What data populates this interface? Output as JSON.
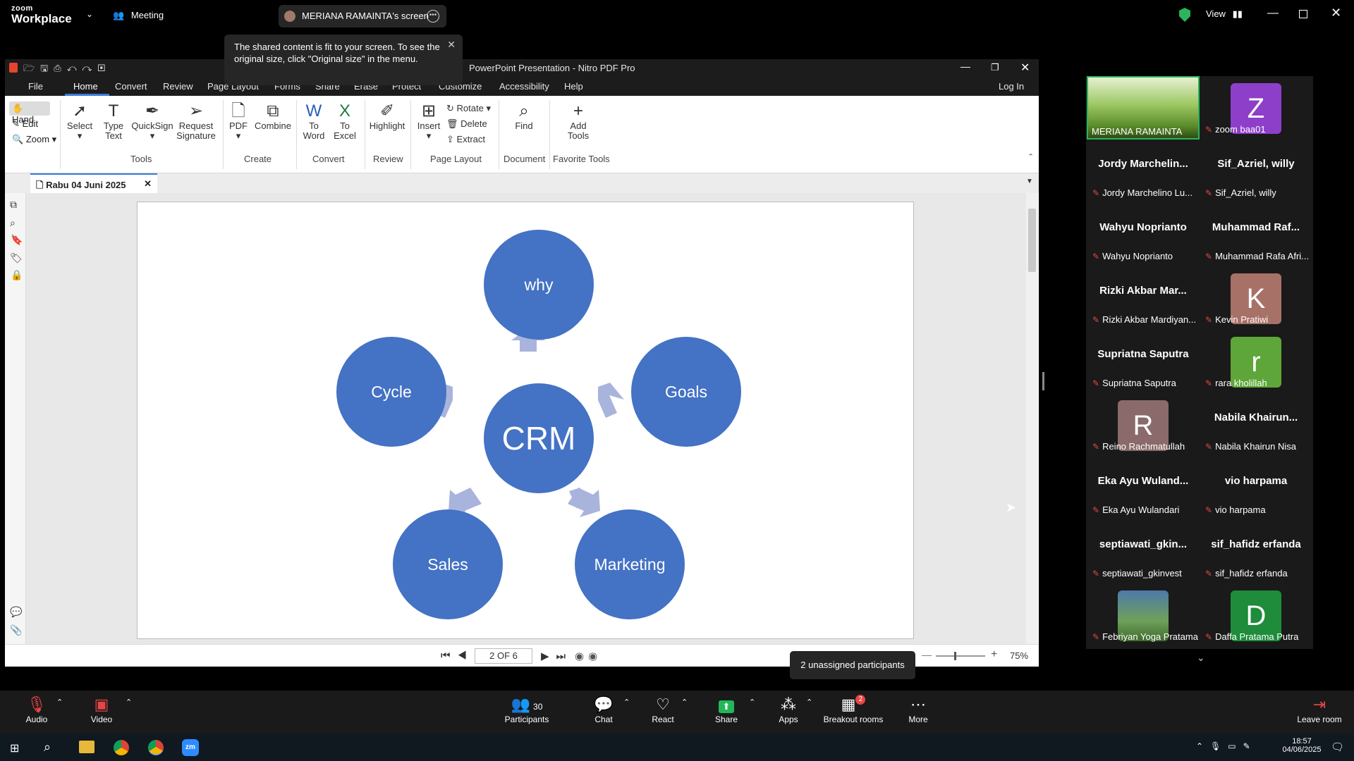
{
  "zoom": {
    "logo_top": "zoom",
    "logo_bottom": "Workplace",
    "meeting_label": "Meeting",
    "share_label": "MERIANA RAMAINTA's screen",
    "view_label": "View",
    "tooltip": "The shared content is fit to your screen. To see the original size, click \"Original size\" in the menu.",
    "unassigned": "2 unassigned participants",
    "toolbar": {
      "audio": "Audio",
      "video": "Video",
      "participants": "Participants",
      "participants_count": "30",
      "chat": "Chat",
      "react": "React",
      "share": "Share",
      "apps": "Apps",
      "breakout": "Breakout rooms",
      "breakout_badge": "2",
      "more": "More",
      "leave": "Leave room"
    }
  },
  "nitro": {
    "title": "PowerPoint Presentation - Nitro PDF Pro",
    "menu": [
      "File",
      "Home",
      "Convert",
      "Review",
      "Page Layout",
      "Forms",
      "Share",
      "Erase",
      "Protect",
      "Customize",
      "Accessibility",
      "Help"
    ],
    "login": "Log In",
    "ribbon": {
      "hand": "Hand",
      "edit": "Edit",
      "zoom": "Zoom",
      "select": "Select",
      "type_text": "Type Text",
      "quicksign": "QuickSign",
      "request_signature": "Request Signature",
      "pdf": "PDF",
      "combine": "Combine",
      "to_word": "To Word",
      "to_excel": "To Excel",
      "highlight": "Highlight",
      "insert": "Insert",
      "rotate": "Rotate",
      "delete": "Delete",
      "extract": "Extract",
      "find": "Find",
      "add_tools": "Add Tools"
    },
    "groups": [
      "Tools",
      "Create",
      "Convert",
      "Review",
      "Page Layout",
      "Document",
      "Favorite Tools"
    ],
    "tab": "Rabu 04 Juni 2025",
    "page_indicator": "2 OF 6",
    "zoom_level": "75%"
  },
  "slide": {
    "center": "CRM",
    "nodes": [
      "why",
      "Goals",
      "Marketing",
      "Sales",
      "Cycle"
    ],
    "colors": {
      "circle": "#4472c4",
      "arrow": "#a9b4dc"
    }
  },
  "participants": [
    {
      "big": "",
      "label": "MERIANA RAMAINTA",
      "kind": "video"
    },
    {
      "big": "Z",
      "label": "zoom baa01",
      "kind": "avatar",
      "color": "#8e3fc9"
    },
    {
      "big": "Jordy  Marchelin...",
      "label": "Jordy Marchelino Lu...",
      "kind": "name"
    },
    {
      "big": "Sif_Azriel, willy",
      "label": "Sif_Azriel, willy",
      "kind": "name"
    },
    {
      "big": "Wahyu Noprianto",
      "label": "Wahyu Noprianto",
      "kind": "name"
    },
    {
      "big": "Muhammad  Raf...",
      "label": "Muhammad Rafa Afri...",
      "kind": "name"
    },
    {
      "big": "Rizki  Akbar  Mar...",
      "label": "Rizki Akbar Mardiyan...",
      "kind": "name"
    },
    {
      "big": "K",
      "label": "Kevin Pratiwi",
      "kind": "avatar",
      "color": "#a87168"
    },
    {
      "big": "Supriatna Saputra",
      "label": "Supriatna Saputra",
      "kind": "name"
    },
    {
      "big": "r",
      "label": "rara kholillah",
      "kind": "avatar",
      "color": "#5ea63a"
    },
    {
      "big": "R",
      "label": "Reino Rachmatullah",
      "kind": "avatar",
      "color": "#8a6a6a"
    },
    {
      "big": "Nabila  Khairun...",
      "label": "Nabila Khairun Nisa",
      "kind": "name"
    },
    {
      "big": "Eka  Ayu  Wuland...",
      "label": "Eka Ayu Wulandari",
      "kind": "name"
    },
    {
      "big": "vio harpama",
      "label": "vio harpama",
      "kind": "name"
    },
    {
      "big": "septiawati_gkin...",
      "label": "septiawati_gkinvest",
      "kind": "name"
    },
    {
      "big": "sif_hafidz erfanda",
      "label": "sif_hafidz erfanda",
      "kind": "name"
    },
    {
      "big": "",
      "label": "Febriyan Yoga Pratama",
      "kind": "photo"
    },
    {
      "big": "D",
      "label": "Daffa Pratama Putra",
      "kind": "avatar",
      "color": "#1e8c3a"
    }
  ],
  "taskbar": {
    "time": "18:57",
    "date": "04/06/2025"
  }
}
